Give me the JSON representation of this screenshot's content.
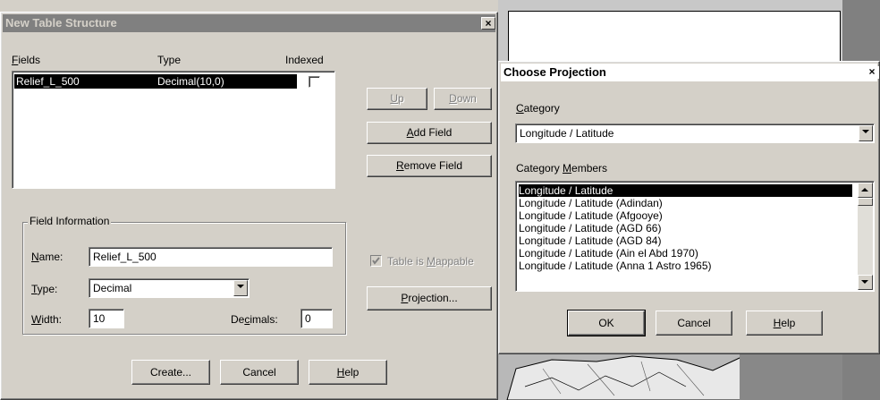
{
  "table_dialog": {
    "title": "New Table Structure",
    "close_label": "×",
    "columns": {
      "fields": "Fields",
      "fields_u": "F",
      "fields_rest": "ields",
      "type": "Type",
      "indexed": "Indexed"
    },
    "rows": [
      {
        "field": "Relief_L_500",
        "type": "Decimal(10,0)",
        "indexed": false
      }
    ],
    "buttons": {
      "up_u": "U",
      "up_rest": "p",
      "down_u": "D",
      "down_rest": "own",
      "add_pre": "",
      "add_u": "A",
      "add_rest": "dd Field",
      "remove_u": "R",
      "remove_rest": "emove Field",
      "projection_u": "P",
      "projection_rest": "rojection...",
      "create": "Create...",
      "cancel": "Cancel",
      "help_u": "H",
      "help_rest": "elp"
    },
    "field_info": {
      "group_label": "Field Information",
      "name_u": "N",
      "name_rest": "ame:",
      "name_value": "Relief_L_500",
      "type_u": "T",
      "type_rest": "ype:",
      "type_value": "Decimal",
      "width_u": "W",
      "width_rest": "idth:",
      "width_value": "10",
      "decimals_pre": "De",
      "decimals_u": "c",
      "decimals_rest": "imals:",
      "decimals_value": "0"
    },
    "mappable": {
      "pre": "Table is ",
      "u": "M",
      "rest": "appable",
      "checked": true
    }
  },
  "projection_dialog": {
    "title": "Choose Projection",
    "close_label": "×",
    "category_u": "C",
    "category_rest": "ategory",
    "category_value": "Longitude / Latitude",
    "members_pre": "Category ",
    "members_u": "M",
    "members_rest": "embers",
    "members": [
      "Longitude / Latitude",
      "Longitude / Latitude (Adindan)",
      "Longitude / Latitude (Afgooye)",
      "Longitude / Latitude (AGD 66)",
      "Longitude / Latitude (AGD 84)",
      "Longitude / Latitude (Ain el Abd 1970)",
      "Longitude / Latitude (Anna 1 Astro 1965)"
    ],
    "selected_index": 0,
    "ok": "OK",
    "cancel": "Cancel",
    "help_u": "H",
    "help_rest": "elp"
  },
  "colors": {
    "selection": "#000000",
    "face": "#d4d0c8",
    "inactive_title": "#808080"
  }
}
